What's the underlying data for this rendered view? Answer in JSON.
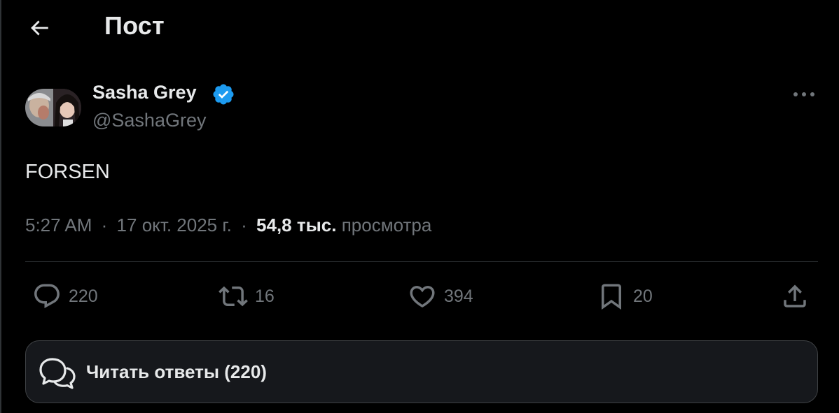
{
  "header": {
    "title": "Пост",
    "back_icon": "arrow-left-icon"
  },
  "tweet": {
    "author": {
      "display_name": "Sasha Grey",
      "handle": "@SashaGrey",
      "verified": true,
      "verified_color": "#1d9bf0"
    },
    "text": "FORSEN",
    "time": "5:27 AM",
    "date": "17 окт. 2025 г.",
    "views_count": "54,8 тыс.",
    "views_label": "просмотра",
    "separator": "·"
  },
  "actions": {
    "replies": "220",
    "reposts": "16",
    "likes": "394",
    "bookmarks": "20"
  },
  "read_replies": {
    "label": "Читать ответы (220)"
  },
  "colors": {
    "background": "#000000",
    "text_primary": "#e7e9ea",
    "text_secondary": "#71767b",
    "border": "#2f3336",
    "accent": "#1d9bf0"
  }
}
